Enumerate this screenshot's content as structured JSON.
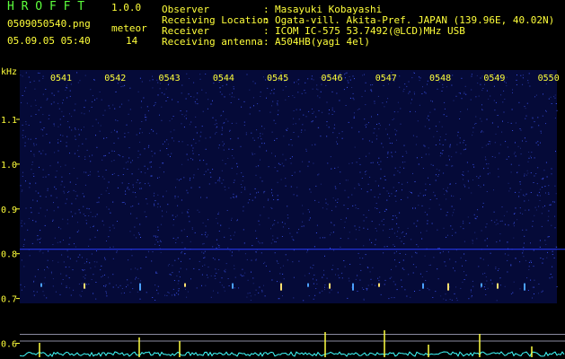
{
  "header": {
    "app_title": "H R O F F T",
    "version": "1.0.0",
    "file_name": "0509050540.png",
    "timestamp": "05.09.05 05:40",
    "meteor_label": "meteor",
    "meteor_count": "14"
  },
  "info": [
    {
      "label": "Observer",
      "value": "Masayuki Kobayashi"
    },
    {
      "label": "Receiving Location",
      "value": "Ogata-vill. Akita-Pref. JAPAN (139.96E, 40.02N)"
    },
    {
      "label": "Receiver",
      "value": "ICOM IC-575 53.7492(@LCD)MHz USB"
    },
    {
      "label": "Receiving antenna",
      "value": "A504HB(yagi 4el)"
    }
  ],
  "separator": ":",
  "colors": {
    "background": "#000000",
    "header_green": "#5cff3c",
    "header_yellow": "#ffff3a",
    "noise_blue": "#3340ff",
    "echo_yellow": "#ffff40",
    "trace_cyan": "#40ffff"
  },
  "chart_data": {
    "type": "heatmap",
    "ylabel": "kHz",
    "yticks": [
      "1.1",
      "1.0",
      "0.9",
      "0.8",
      "0.7",
      "0.6"
    ],
    "ytick_values": [
      1.1,
      1.0,
      0.9,
      0.8,
      0.7,
      0.6
    ],
    "ylim": [
      0.56,
      1.2
    ],
    "xticks": [
      "0541",
      "0542",
      "0543",
      "0544",
      "0545",
      "0546",
      "0547",
      "0548",
      "0549",
      "0550"
    ],
    "meteor_count": 14
  }
}
